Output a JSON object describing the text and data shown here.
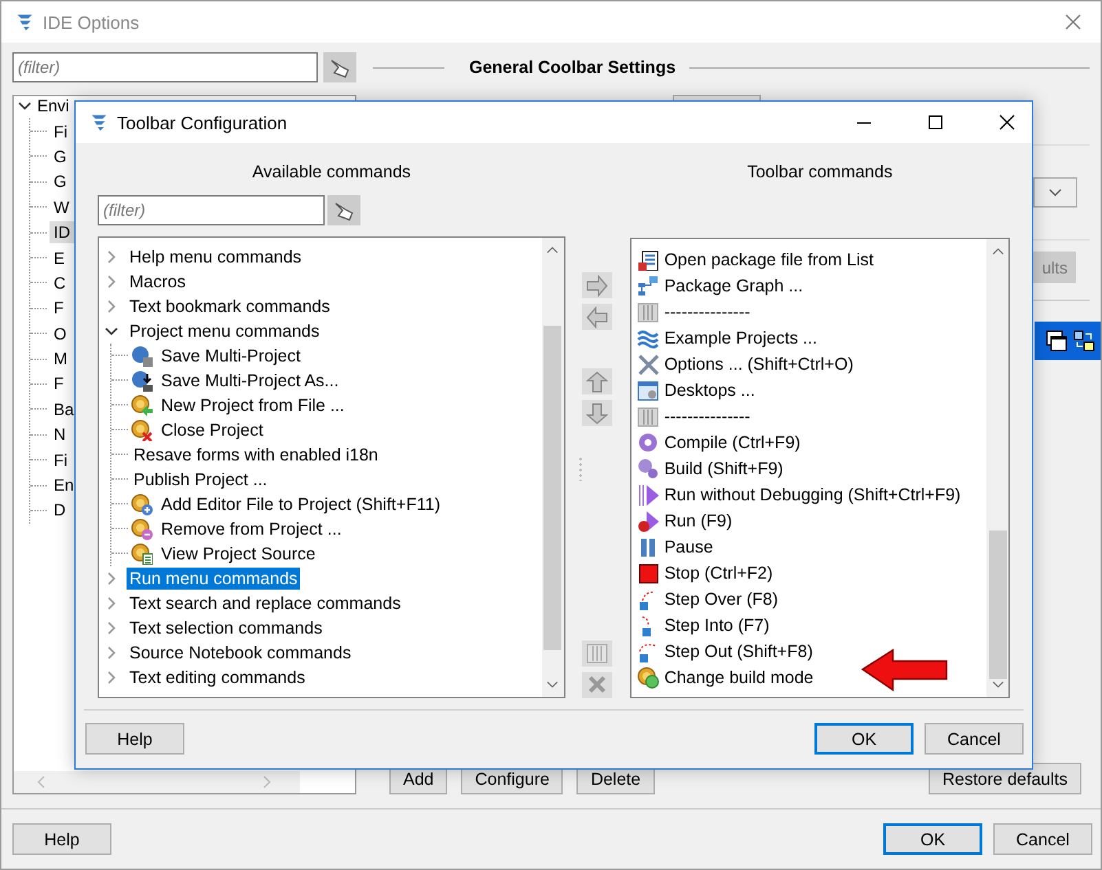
{
  "ide_window": {
    "title": "IDE Options",
    "filter": {
      "placeholder": "(filter)"
    },
    "section_title": "General Coolbar Settings",
    "tree": {
      "label": "Envi",
      "expanded": true,
      "children": [
        {
          "label": "Fi",
          "selected": false
        },
        {
          "label": "G",
          "selected": false
        },
        {
          "label": "G",
          "selected": false
        },
        {
          "label": "W",
          "selected": false
        },
        {
          "label": "ID",
          "selected": true
        },
        {
          "label": "E",
          "selected": false
        },
        {
          "label": "C",
          "selected": false
        },
        {
          "label": "F",
          "selected": false
        },
        {
          "label": "O",
          "selected": false
        },
        {
          "label": "M",
          "selected": false
        },
        {
          "label": "F",
          "selected": false
        },
        {
          "label": "Ba",
          "selected": false
        },
        {
          "label": "N",
          "selected": false
        },
        {
          "label": "Fi",
          "selected": false
        },
        {
          "label": "En",
          "selected": false
        },
        {
          "label": "D",
          "selected": false
        }
      ]
    },
    "partial_button": "ults",
    "toolbar_buttons": [
      "Add",
      "Configure",
      "Delete"
    ],
    "restore_button": "Restore defaults",
    "footer_buttons": [
      {
        "label": "Help",
        "default": false
      },
      {
        "label": "OK",
        "default": true
      },
      {
        "label": "Cancel",
        "default": false
      }
    ]
  },
  "dialog": {
    "title": "Toolbar Configuration",
    "available": {
      "title": "Available commands",
      "filter": {
        "placeholder": "(filter)"
      },
      "items": [
        {
          "label": "Help menu commands",
          "expanded": false,
          "selected": false
        },
        {
          "label": "Macros",
          "expanded": false,
          "selected": false
        },
        {
          "label": "Text bookmark commands",
          "expanded": false,
          "selected": false
        },
        {
          "label": "Project menu commands",
          "expanded": true,
          "selected": false,
          "children": [
            {
              "label": "Save Multi-Project",
              "kind": "disk"
            },
            {
              "label": "Save Multi-Project As...",
              "kind": "disk-arrow"
            },
            {
              "label": "New Project from File ...",
              "kind": "coin-arrow"
            },
            {
              "label": "Close Project",
              "kind": "coin-x"
            },
            {
              "label": "Resave forms with enabled i18n",
              "kind": "plain"
            },
            {
              "label": "Publish Project ...",
              "kind": "plain"
            },
            {
              "label": "Add Editor File to Project (Shift+F11)",
              "kind": "coin-plus"
            },
            {
              "label": "Remove from Project ...",
              "kind": "coin-minus"
            },
            {
              "label": "View Project Source",
              "kind": "coin-doc"
            }
          ]
        },
        {
          "label": "Run menu commands",
          "expanded": false,
          "selected": true
        },
        {
          "label": "Text search and replace commands",
          "expanded": false,
          "selected": false
        },
        {
          "label": "Text selection commands",
          "expanded": false,
          "selected": false
        },
        {
          "label": "Source Notebook commands",
          "expanded": false,
          "selected": false
        },
        {
          "label": "Text editing commands",
          "expanded": false,
          "selected": false
        }
      ]
    },
    "toolbar": {
      "title": "Toolbar commands",
      "items": [
        {
          "label": "Open package file from List",
          "kind": "open-list"
        },
        {
          "label": "Package Graph ...",
          "kind": "graph"
        },
        {
          "label": "---------------",
          "kind": "bars"
        },
        {
          "label": "Example Projects ...",
          "kind": "waves"
        },
        {
          "label": "Options ... (Shift+Ctrl+O)",
          "kind": "tools"
        },
        {
          "label": "Desktops ...",
          "kind": "desktop"
        },
        {
          "label": "---------------",
          "kind": "bars"
        },
        {
          "label": "Compile (Ctrl+F9)",
          "kind": "gear"
        },
        {
          "label": "Build (Shift+F9)",
          "kind": "gears"
        },
        {
          "label": "Run without Debugging (Shift+Ctrl+F9)",
          "kind": "play"
        },
        {
          "label": "Run (F9)",
          "kind": "play-bug"
        },
        {
          "label": "Pause",
          "kind": "pause"
        },
        {
          "label": "Stop (Ctrl+F2)",
          "kind": "stop"
        },
        {
          "label": "Step Over (F8)",
          "kind": "step-over"
        },
        {
          "label": "Step Into (F7)",
          "kind": "step-into"
        },
        {
          "label": "Step Out (Shift+F8)",
          "kind": "step-out"
        },
        {
          "label": "Change build mode",
          "kind": "coin-green"
        }
      ]
    },
    "footer_buttons": [
      {
        "label": "Help",
        "default": false
      },
      {
        "label": "OK",
        "default": true
      },
      {
        "label": "Cancel",
        "default": false
      }
    ]
  }
}
